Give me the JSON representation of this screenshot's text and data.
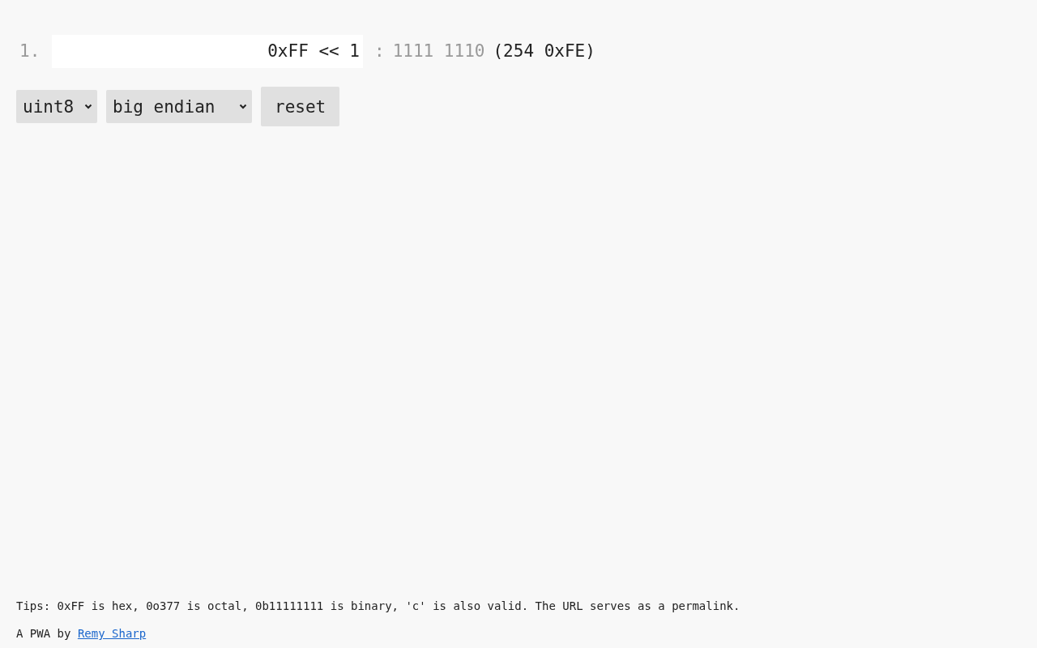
{
  "lines": [
    {
      "number": "1.",
      "expression": "0xFF << 1",
      "separator": ":",
      "binary": "1111 1110",
      "value": "(254 0xFE)"
    }
  ],
  "controls": [
    {
      "kind": "select",
      "value": "uint8"
    },
    {
      "kind": "select",
      "value": "big endian"
    },
    {
      "kind": "button",
      "label": "reset"
    }
  ],
  "footer": {
    "tips": "Tips: 0xFF is hex, 0o377 is octal, 0b11111111 is binary, 'c' is also valid. The URL serves as a permalink.",
    "credit": "A PWA by",
    "link": "Remy Sharp"
  }
}
